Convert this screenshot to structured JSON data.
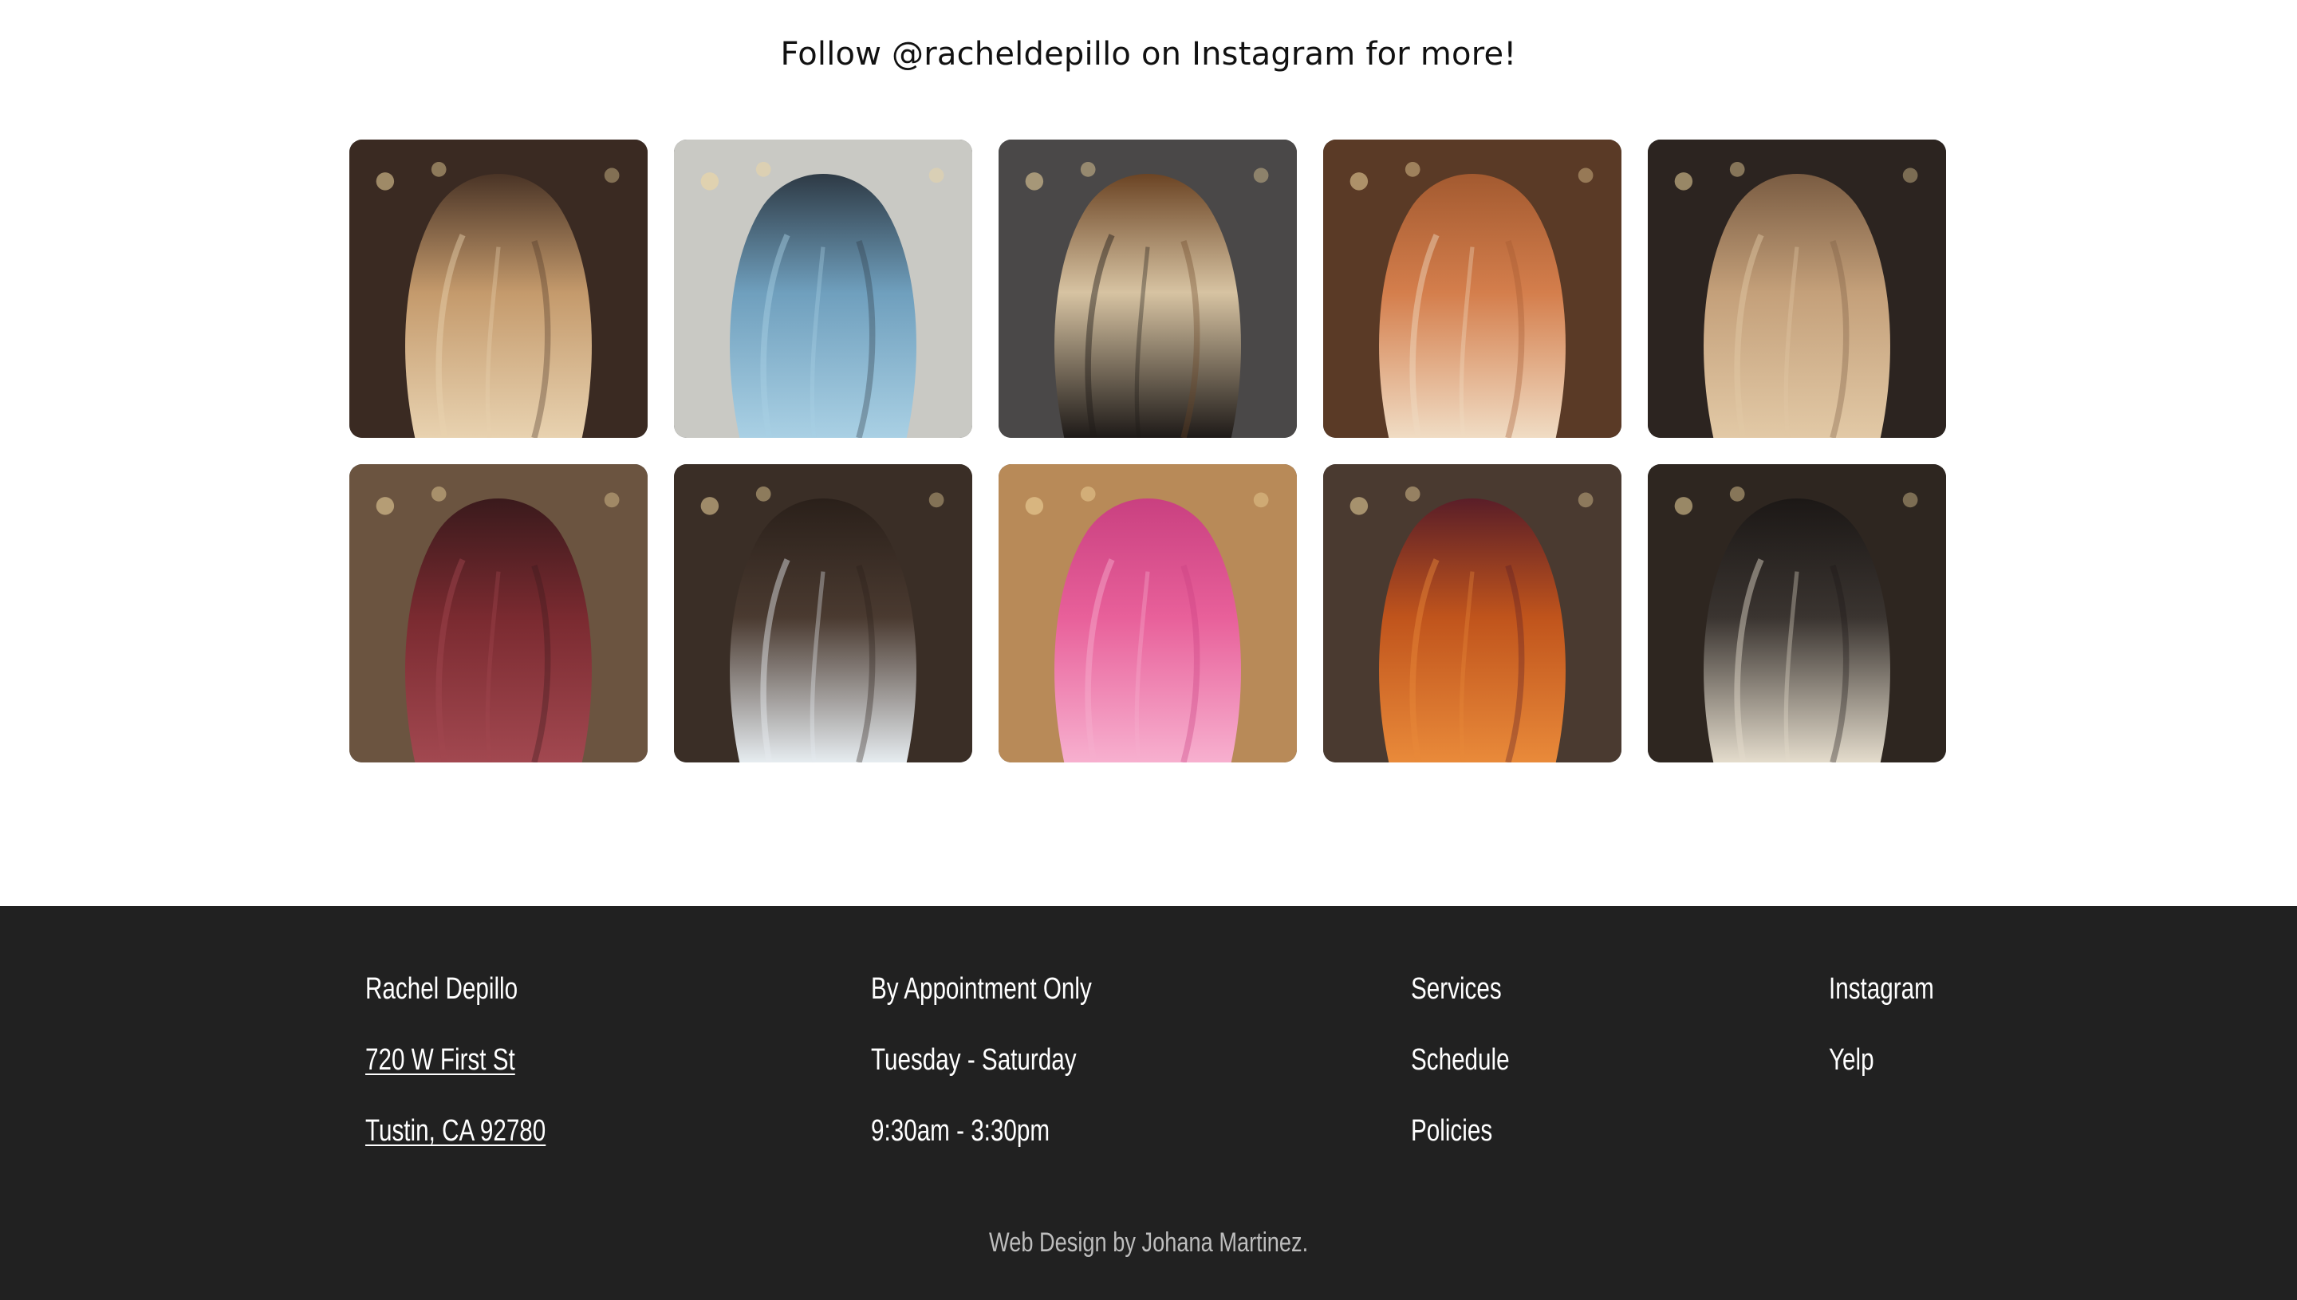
{
  "heading": {
    "text": "Follow @racheldepillo on Instagram for more!"
  },
  "gallery": {
    "photos": [
      {
        "name": "photo-balayage-waves",
        "bg": "#3a2a22",
        "hair": "#c49a6c",
        "root": "#4a3426",
        "accent": "#e8d2b0"
      },
      {
        "name": "photo-blue-waves",
        "bg": "#c9c9c4",
        "hair": "#6f9fbd",
        "root": "#2e3a45",
        "accent": "#a9d0e4"
      },
      {
        "name": "photo-leopard-print-buzz",
        "bg": "#4a4848",
        "hair": "#d7c3a2",
        "root": "#6b4424",
        "accent": "#1e1a18"
      },
      {
        "name": "photo-copper-money-piece",
        "bg": "#5a3a26",
        "hair": "#d47e4c",
        "root": "#a35a30",
        "accent": "#f0dcc4"
      },
      {
        "name": "photo-honey-blonde",
        "bg": "#2c2420",
        "hair": "#c4a07a",
        "root": "#7a5c42",
        "accent": "#e2c9a6"
      },
      {
        "name": "photo-burgundy-waves",
        "bg": "#6b5440",
        "hair": "#7a2a30",
        "root": "#3a1a1c",
        "accent": "#a24850"
      },
      {
        "name": "photo-brunette-bob",
        "bg": "#3a2e26",
        "hair": "#4a3a30",
        "root": "#2a201a",
        "accent": "#e6ecf0"
      },
      {
        "name": "photo-pink-layers",
        "bg": "#b88a58",
        "hair": "#e8609a",
        "root": "#c94080",
        "accent": "#f7b0cf"
      },
      {
        "name": "photo-burgundy-copper-ombre",
        "bg": "#4a3a30",
        "hair": "#c0541c",
        "root": "#5a1e28",
        "accent": "#e98a3a"
      },
      {
        "name": "photo-black-blonde-streaks",
        "bg": "#2e2620",
        "hair": "#3a3430",
        "root": "#1c1816",
        "accent": "#e4dccc"
      }
    ]
  },
  "footer": {
    "colors": {
      "background": "#212121",
      "text": "#ffffff",
      "credit": "#bdbdbd"
    },
    "contact": {
      "name": "Rachel Depillo",
      "address_line1": "720 W First St",
      "address_line2": "Tustin, CA 92780"
    },
    "hours": {
      "line1": "By Appointment Only",
      "line2": "Tuesday - Saturday",
      "line3": "9:30am - 3:30pm"
    },
    "nav": {
      "services": "Services",
      "schedule": "Schedule",
      "policies": "Policies"
    },
    "social": {
      "instagram": "Instagram",
      "yelp": "Yelp"
    },
    "credit": "Web Design by Johana Martinez."
  }
}
